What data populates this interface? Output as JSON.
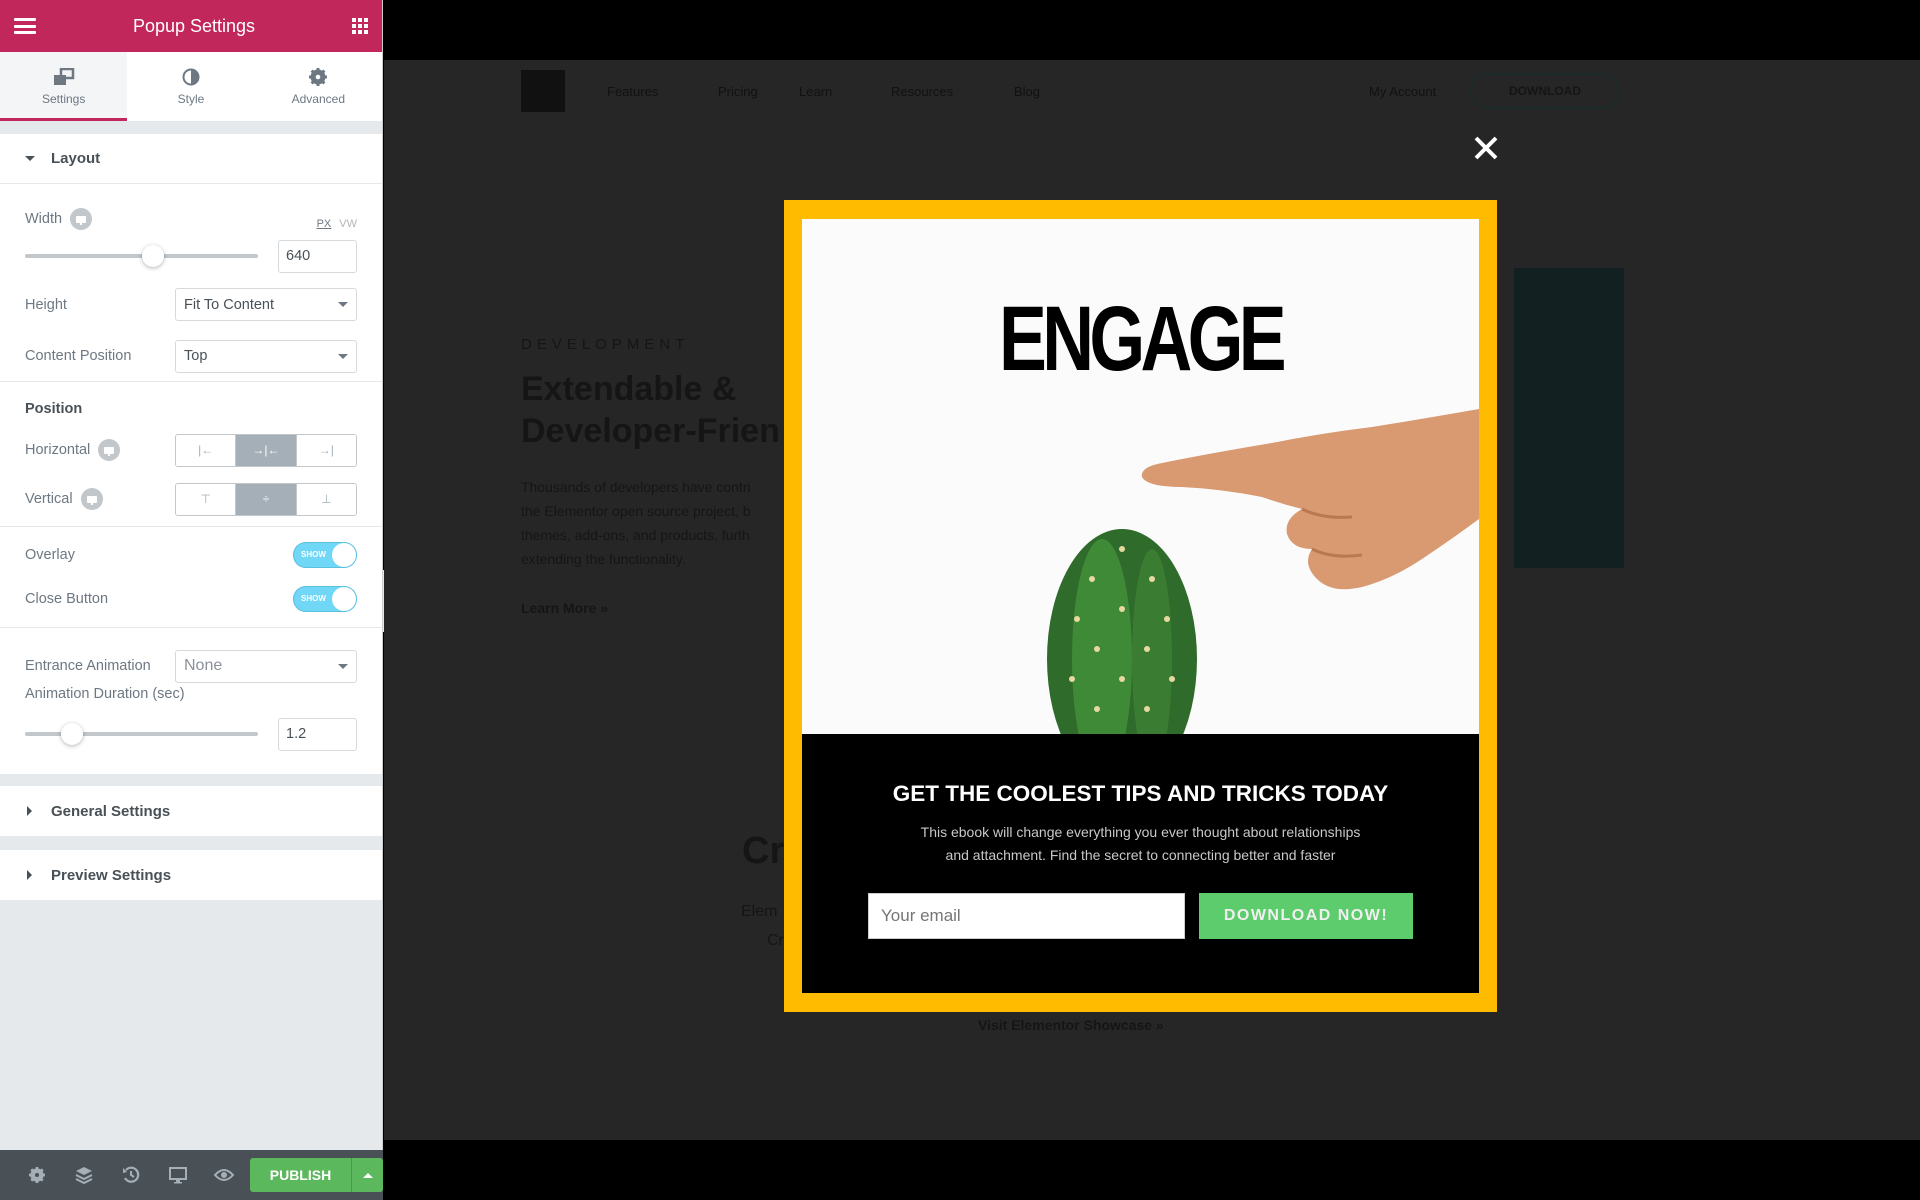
{
  "panel": {
    "title": "Popup Settings",
    "tabs": [
      {
        "label": "Settings",
        "icon": "settings-windows-icon",
        "active": true
      },
      {
        "label": "Style",
        "icon": "half-circle-icon",
        "active": false
      },
      {
        "label": "Advanced",
        "icon": "gear-icon",
        "active": false
      }
    ],
    "layout": {
      "heading": "Layout",
      "width": {
        "label": "Width",
        "units": [
          "PX",
          "VW"
        ],
        "active_unit": "PX",
        "value": "640",
        "slider_fraction": 0.55
      },
      "height": {
        "label": "Height",
        "value": "Fit To Content"
      },
      "content_position": {
        "label": "Content Position",
        "value": "Top"
      },
      "position_heading": "Position",
      "horizontal": {
        "label": "Horizontal",
        "options": [
          "left",
          "center",
          "right"
        ],
        "selected": "center"
      },
      "vertical": {
        "label": "Vertical",
        "options": [
          "top",
          "middle",
          "bottom"
        ],
        "selected": "middle"
      },
      "overlay": {
        "label": "Overlay",
        "state": "SHOW"
      },
      "close_button": {
        "label": "Close Button",
        "state": "SHOW"
      },
      "entrance_animation": {
        "label": "Entrance Animation",
        "value": "None"
      },
      "animation_duration": {
        "label": "Animation Duration (sec)",
        "value": "1.2",
        "slider_fraction": 0.2
      }
    },
    "general_settings": "General Settings",
    "preview_settings": "Preview Settings",
    "footer": {
      "publish_label": "PUBLISH"
    }
  },
  "site": {
    "nav": [
      "Features",
      "Pricing",
      "Learn",
      "Resources",
      "Blog"
    ],
    "my_account": "My Account",
    "download": "DOWNLOAD",
    "eyebrow": "DEVELOPMENT",
    "headline_1": "Extendable &",
    "headline_2": "Developer-Frien",
    "body_lines": [
      "Thousands of developers have contri",
      "the Elementor open source project, b",
      "themes, add-ons, and products, furth",
      "extending the functionality."
    ],
    "learn_more": "Learn More »",
    "cr_heading": "Cr",
    "cr_line1": "Elem",
    "cr_line2": "Cr",
    "showcase_link": "Visit Elementor Showcase »"
  },
  "popup": {
    "image_text": "ENGAGE",
    "heading": "GET THE COOLEST TIPS AND TRICKS TODAY",
    "paragraph_1": "This ebook will change everything you ever thought about relationships",
    "paragraph_2": "and attachment. Find the secret to connecting better and faster",
    "email_placeholder": "Your email",
    "button_label": "DOWNLOAD NOW!",
    "border_color": "#ffbb00",
    "button_color": "#5ccc6c"
  },
  "colors": {
    "brand": "#c2275b",
    "publish": "#5cb85c",
    "toggle": "#71d7f7"
  }
}
